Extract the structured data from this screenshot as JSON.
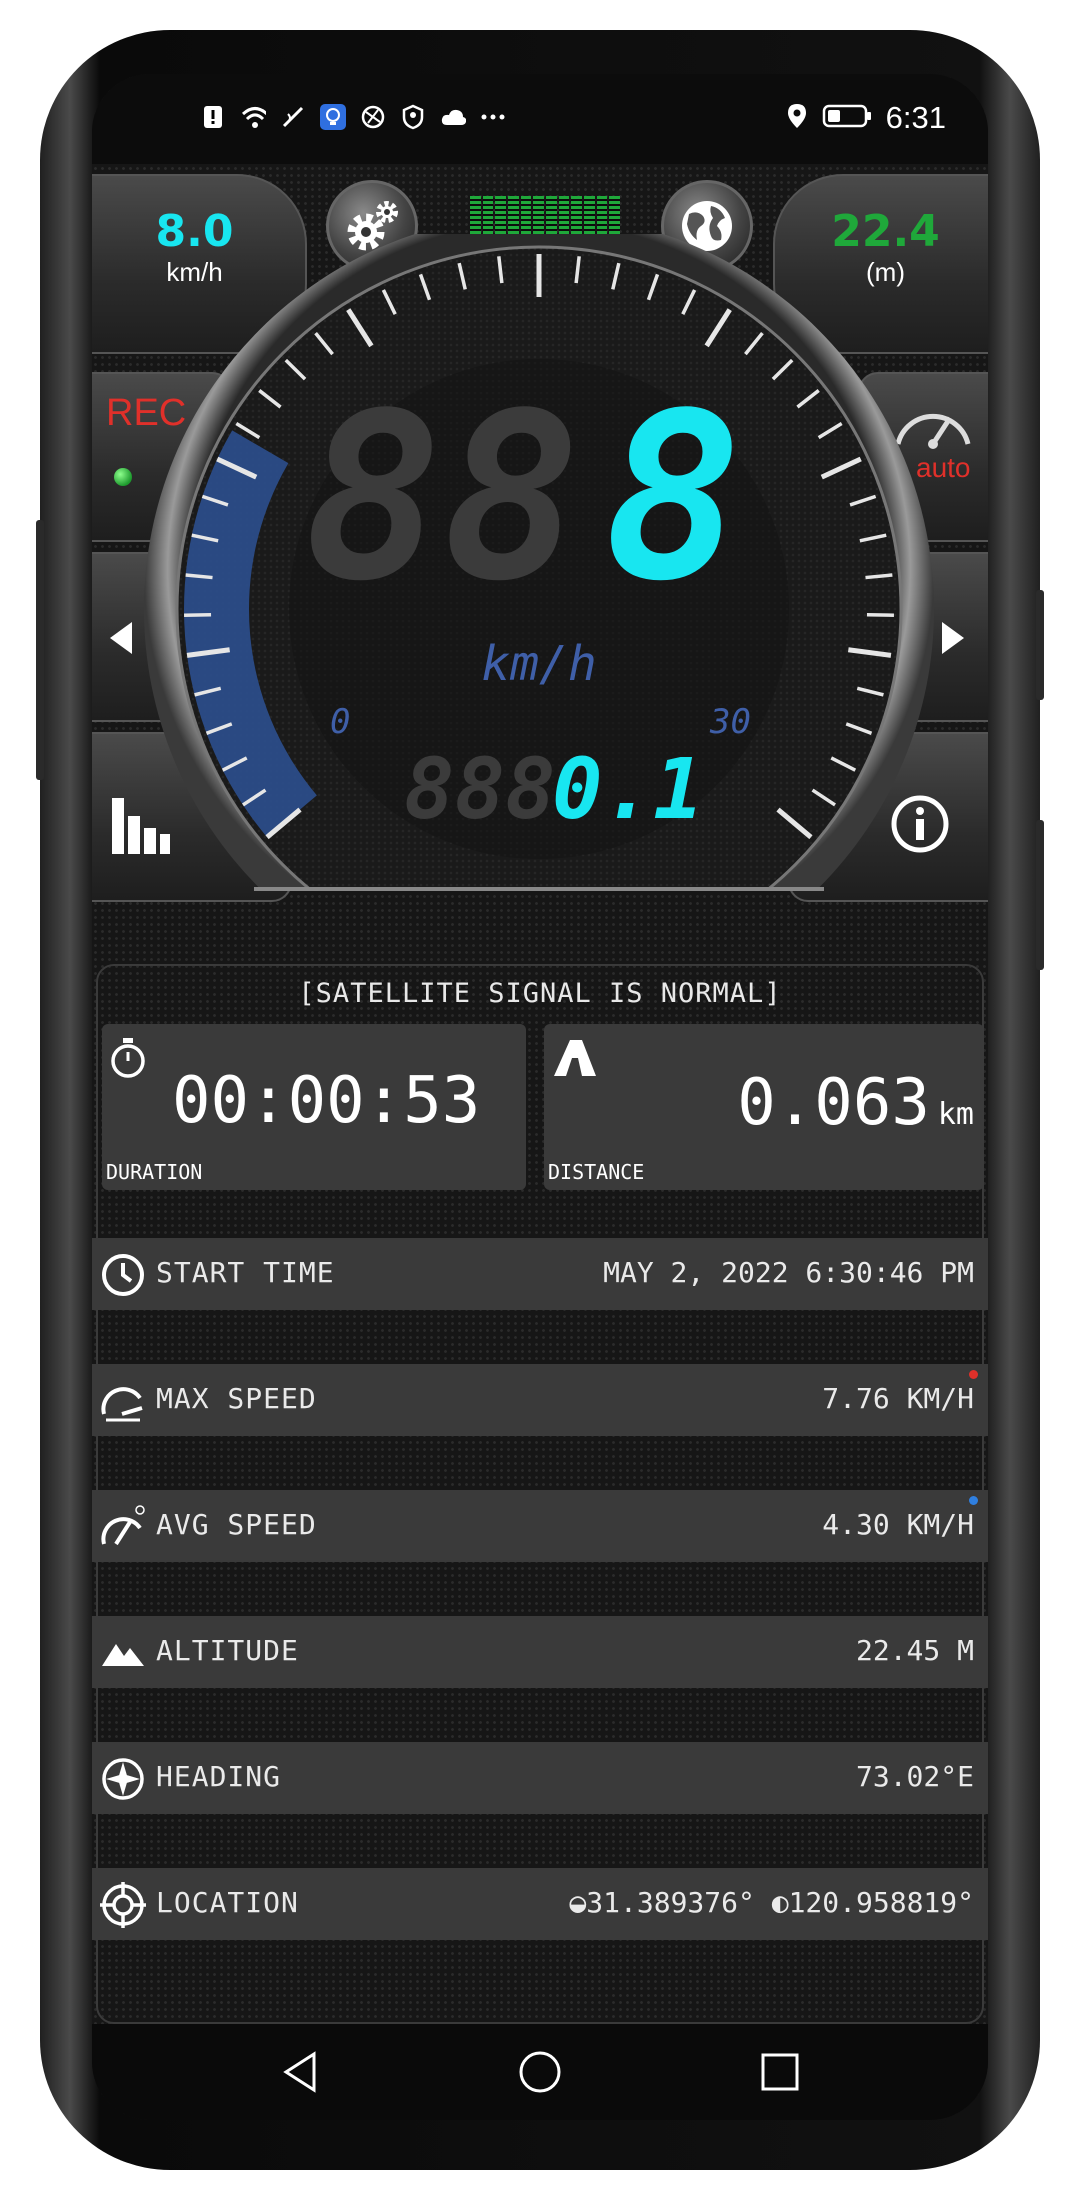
{
  "status_bar": {
    "time": "6:31",
    "icons": [
      "alert-icon",
      "wifi-icon",
      "nfc-icon",
      "bulb-icon",
      "vpn-icon",
      "shield-icon",
      "cloud-icon",
      "more-icon"
    ],
    "right_icons": [
      "location-icon",
      "battery-icon"
    ]
  },
  "top": {
    "speed_value": "8.0",
    "speed_unit": "km/h",
    "altitude_value": "22.4",
    "altitude_unit": "(m)",
    "signal_bars": 12
  },
  "side": {
    "rec_label": "REC",
    "auto_label": "auto"
  },
  "gauge": {
    "digits_dim": "88",
    "digit_active": "8",
    "unit": "km/h",
    "scale_min": "0",
    "scale_max": "30",
    "odo_dim": "888",
    "odo_active": "0.1",
    "arc_fraction": 0.27
  },
  "info": {
    "signal_text": "[SATELLITE SIGNAL IS NORMAL]",
    "duration_value": "00:00:53",
    "duration_label": "DURATION",
    "distance_value": "0.063",
    "distance_unit": "km",
    "distance_label": "DISTANCE",
    "rows": [
      {
        "label": "START TIME",
        "value": "MAY 2, 2022 6:30:46 PM"
      },
      {
        "label": "MAX SPEED",
        "value": "7.76 KM/H"
      },
      {
        "label": "AVG SPEED",
        "value": "4.30 KM/H"
      },
      {
        "label": "ALTITUDE",
        "value": "22.45 M"
      },
      {
        "label": "HEADING",
        "value": "73.02°E"
      },
      {
        "label": "LOCATION",
        "value": "◒31.389376° ◐120.958819°"
      }
    ]
  },
  "colors": {
    "cyan": "#18e6f0",
    "green": "#1fa83a",
    "red": "#e0302a",
    "blue_arc": "#2c4f8e"
  }
}
